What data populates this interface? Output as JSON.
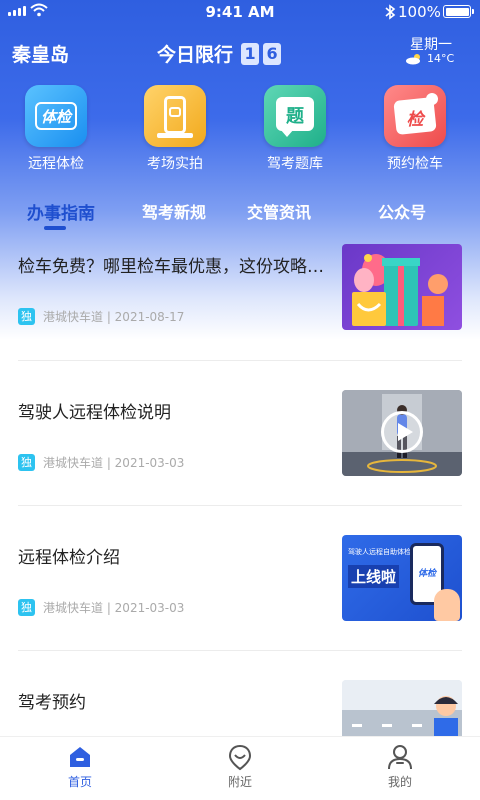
{
  "status_bar": {
    "time": "9:41 AM",
    "battery": "100%",
    "icons": [
      "signal-icon",
      "wifi-icon",
      "bluetooth-icon",
      "battery-icon"
    ]
  },
  "header": {
    "city": "秦皇岛",
    "limit_label": "今日限行",
    "limit_numbers": [
      "1",
      "6"
    ],
    "weekday": "星期一",
    "temperature": "14°C",
    "weather_icon": "partly-cloudy-icon"
  },
  "quick_actions": [
    {
      "label": "远程体检",
      "icon_text": "体检",
      "icon": "health-check-icon",
      "color": "#1a8ff0"
    },
    {
      "label": "考场实拍",
      "icon": "camera-phone-icon",
      "color": "#f2a91c"
    },
    {
      "label": "驾考题库",
      "icon_text": "题",
      "icon": "question-bank-icon",
      "color": "#1fb08a"
    },
    {
      "label": "预约检车",
      "icon_text": "检",
      "icon": "vehicle-inspection-icon",
      "color": "#ee4b4b"
    }
  ],
  "tabs": [
    {
      "label": "办事指南",
      "active": true
    },
    {
      "label": "驾考新规",
      "active": false
    },
    {
      "label": "交管资讯",
      "active": false
    },
    {
      "label": "公众号",
      "active": false
    }
  ],
  "articles": [
    {
      "title": "检车免费？哪里检车最优惠，这份攻略…",
      "badge": "独",
      "source": "港城快车道 | 2021-08-17"
    },
    {
      "title": "驾驶人远程体检说明",
      "badge": "独",
      "source": "港城快车道 | 2021-03-03"
    },
    {
      "title": "远程体检介绍",
      "badge": "独",
      "source": "港城快车道 | 2021-03-03",
      "thumb_text_small": "驾驶人远程自助体检",
      "thumb_text_big": "上线啦",
      "thumb_phone_text": "体检"
    },
    {
      "title": "驾考预约"
    }
  ],
  "tab_bar": [
    {
      "label": "首页",
      "active": true,
      "icon": "home-icon"
    },
    {
      "label": "附近",
      "active": false,
      "icon": "location-icon"
    },
    {
      "label": "我的",
      "active": false,
      "icon": "profile-icon"
    }
  ],
  "colors": {
    "primary": "#2f5fe0",
    "active_tab": "#1f4fcf",
    "badge": "#2dc3f0"
  }
}
